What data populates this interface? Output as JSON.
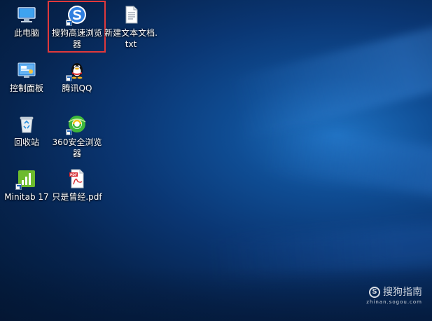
{
  "desktop": {
    "icons": [
      {
        "label": "此电脑"
      },
      {
        "label": "搜狗高速浏览器"
      },
      {
        "label": "新建文本文档.txt"
      },
      {
        "label": "控制面板"
      },
      {
        "label": "腾讯QQ"
      },
      {
        "label": "回收站"
      },
      {
        "label": "360安全浏览器"
      },
      {
        "label": "Minitab 17"
      },
      {
        "label": "只是曾经.pdf"
      }
    ],
    "selected_icon": "搜狗高速浏览器",
    "highlight_color": "#e0393b"
  },
  "watermark": {
    "text": "搜狗指南",
    "url": "zhinan.sogou.com"
  }
}
